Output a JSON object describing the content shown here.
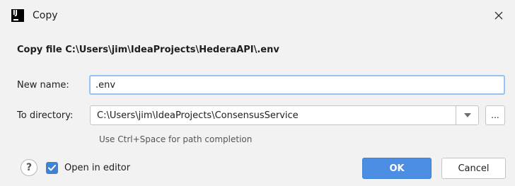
{
  "window": {
    "title": "Copy",
    "app_icon": "intellij-icon",
    "close_icon": "close-icon",
    "app_icon_text": "IJ"
  },
  "heading": "Copy file C:\\Users\\jim\\IdeaProjects\\HederaAPI\\.env",
  "form": {
    "new_name_label": "New name:",
    "new_name_value": ".env",
    "to_directory_label": "To directory:",
    "to_directory_value": "C:\\Users\\jim\\IdeaProjects\\ConsensusService",
    "dropdown_icon": "chevron-down-icon",
    "browse_label": "...",
    "hint": "Use Ctrl+Space for path completion"
  },
  "footer": {
    "help_label": "?",
    "open_in_editor_label": "Open in editor",
    "open_in_editor_checked": true,
    "ok_label": "OK",
    "cancel_label": "Cancel"
  },
  "colors": {
    "background": "#f2f2f2",
    "accent": "#4b8ee3",
    "focus_border": "#97c3f3",
    "checkbox": "#3c83d6"
  }
}
